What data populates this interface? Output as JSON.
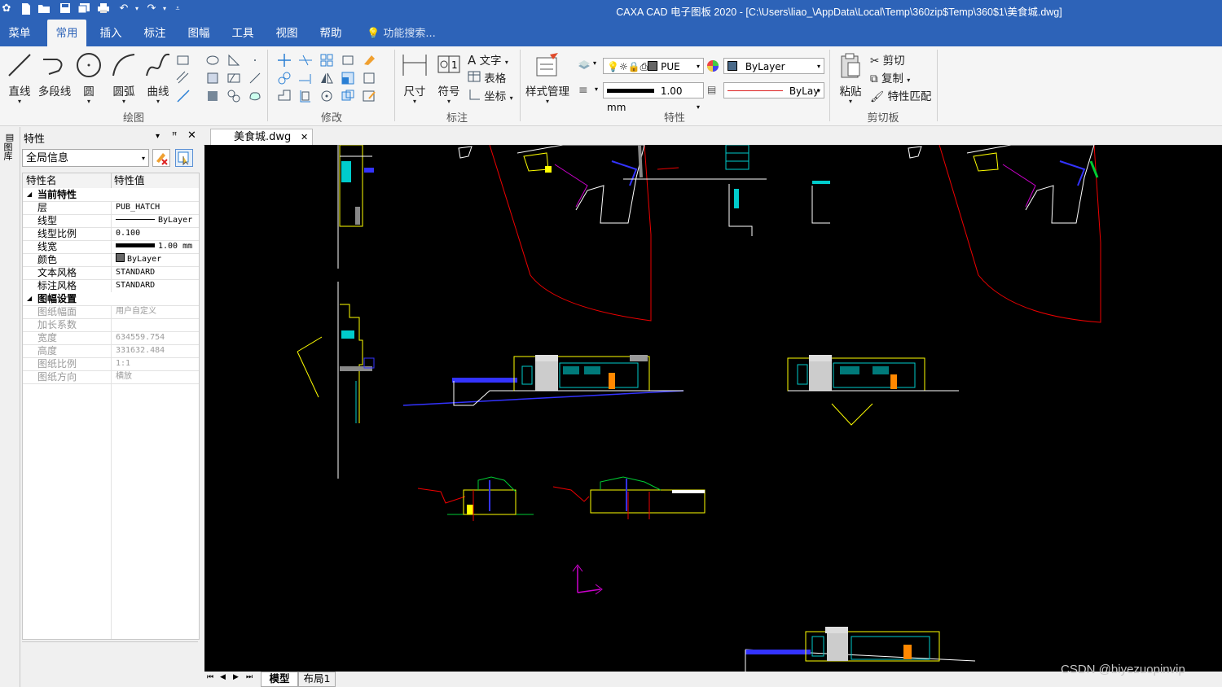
{
  "window": {
    "title": "CAXA CAD 电子图板 2020 - [C:\\Users\\liao_\\AppData\\Local\\Temp\\360zip$Temp\\360$1\\美食城.dwg]"
  },
  "menu_tabs": [
    "菜单",
    "常用",
    "插入",
    "标注",
    "图幅",
    "工具",
    "视图",
    "帮助"
  ],
  "search": {
    "label": "功能搜索..."
  },
  "ribbon": {
    "draw": {
      "label": "绘图",
      "buttons": [
        "直线",
        "多段线",
        "圆",
        "圆弧",
        "曲线"
      ]
    },
    "modify": {
      "label": "修改"
    },
    "annotate": {
      "label": "标注",
      "buttons": [
        "尺寸",
        "符号"
      ],
      "small": [
        "文字",
        "表格",
        "坐标"
      ]
    },
    "properties": {
      "label": "特性",
      "style_button": "样式管理",
      "layer_value": "PUE",
      "color_value": "ByLayer",
      "lineweight_value": "1.00 mm",
      "linetype_value": "ByLay"
    },
    "clipboard": {
      "label": "剪切板",
      "paste": "粘贴",
      "small": [
        "剪切",
        "复制",
        "特性匹配"
      ]
    }
  },
  "side_strip": {
    "label": "图库"
  },
  "panel": {
    "title": "特性",
    "dropdown": "全局信息",
    "col_name": "特性名",
    "col_value": "特性值",
    "rows": [
      {
        "type": "cat",
        "name": "当前特性"
      },
      {
        "name": "层",
        "value": "PUB_HATCH"
      },
      {
        "name": "线型",
        "value": "ByLayer",
        "swatch": "line"
      },
      {
        "name": "线型比例",
        "value": "0.100"
      },
      {
        "name": "线宽",
        "value": "1.00 mm",
        "swatch": "thick"
      },
      {
        "name": "颜色",
        "value": "ByLayer",
        "swatch": "box"
      },
      {
        "name": "文本风格",
        "value": "STANDARD"
      },
      {
        "name": "标注风格",
        "value": "STANDARD"
      },
      {
        "type": "cat",
        "name": "图幅设置"
      },
      {
        "name": "图纸幅面",
        "value": "用户自定义",
        "disabled": true
      },
      {
        "name": "加长系数",
        "value": "",
        "disabled": true
      },
      {
        "name": "宽度",
        "value": "634559.754",
        "disabled": true
      },
      {
        "name": "高度",
        "value": "331632.484",
        "disabled": true
      },
      {
        "name": "图纸比例",
        "value": "1:1",
        "disabled": true
      },
      {
        "name": "图纸方向",
        "value": "横放",
        "disabled": true
      }
    ]
  },
  "doc_tab": {
    "label": "美食城.dwg"
  },
  "layout_tabs": [
    "模型",
    "布局1"
  ],
  "watermark": "CSDN @biyezuopinvip",
  "colors": {
    "accent": "#2d63b8",
    "canvas": "#000000"
  }
}
